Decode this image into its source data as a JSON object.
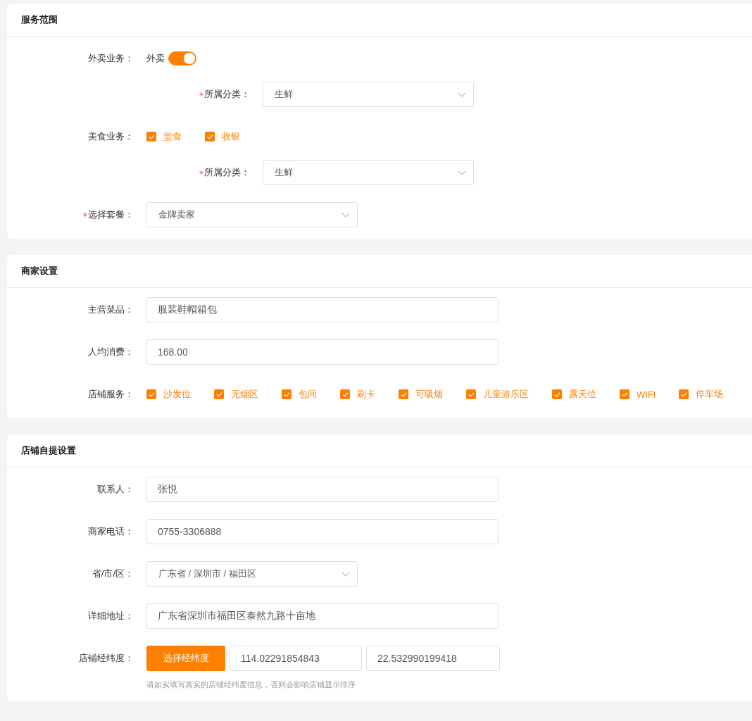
{
  "sections": [
    {
      "title": "服务范围",
      "rows": [
        {
          "kind": "switch",
          "label": "外卖业务：",
          "text": "外卖",
          "on": true
        },
        {
          "kind": "sub_select",
          "label": "所属分类：",
          "required": true,
          "value": "生鲜"
        },
        {
          "kind": "checks",
          "label": "美食业务：",
          "options": [
            {
              "label": "堂食",
              "checked": true
            },
            {
              "label": "收银",
              "checked": true
            }
          ]
        },
        {
          "kind": "sub_select",
          "label": "所属分类：",
          "required": true,
          "value": "生鲜"
        },
        {
          "kind": "select",
          "label": "选择套餐：",
          "required": true,
          "value": "金牌卖家"
        }
      ]
    },
    {
      "title": "商家设置",
      "rows": [
        {
          "kind": "input",
          "label": "主营菜品：",
          "value": "服装鞋帽箱包"
        },
        {
          "kind": "input",
          "label": "人均消费：",
          "value": "168.00"
        },
        {
          "kind": "checks",
          "label": "店铺服务：",
          "options": [
            {
              "label": "沙发位",
              "checked": true
            },
            {
              "label": "无烟区",
              "checked": true
            },
            {
              "label": "包间",
              "checked": true
            },
            {
              "label": "刷卡",
              "checked": true
            },
            {
              "label": "可吸烟",
              "checked": true
            },
            {
              "label": "儿童游乐区",
              "checked": true
            },
            {
              "label": "露天位",
              "checked": true
            },
            {
              "label": "WIFI",
              "checked": true
            },
            {
              "label": "停车场",
              "checked": true
            }
          ]
        }
      ]
    },
    {
      "title": "店铺自提设置",
      "rows": [
        {
          "kind": "input",
          "label": "联系人：",
          "value": "张悦"
        },
        {
          "kind": "input",
          "label": "商家电话：",
          "value": "0755-3306888"
        },
        {
          "kind": "select",
          "label": "省/市/区：",
          "required": false,
          "value": "广东省 / 深圳市 / 福田区"
        },
        {
          "kind": "input",
          "label": "详细地址：",
          "value": "广东省深圳市福田区泰然九路十亩地"
        },
        {
          "kind": "coords",
          "label": "店铺经纬度：",
          "button": "选择经纬度",
          "values": [
            "114.02291854843",
            "22.532990199418"
          ],
          "hint": "请如实填写真实的店铺经纬度信息，否则会影响店铺显示排序"
        }
      ]
    }
  ]
}
